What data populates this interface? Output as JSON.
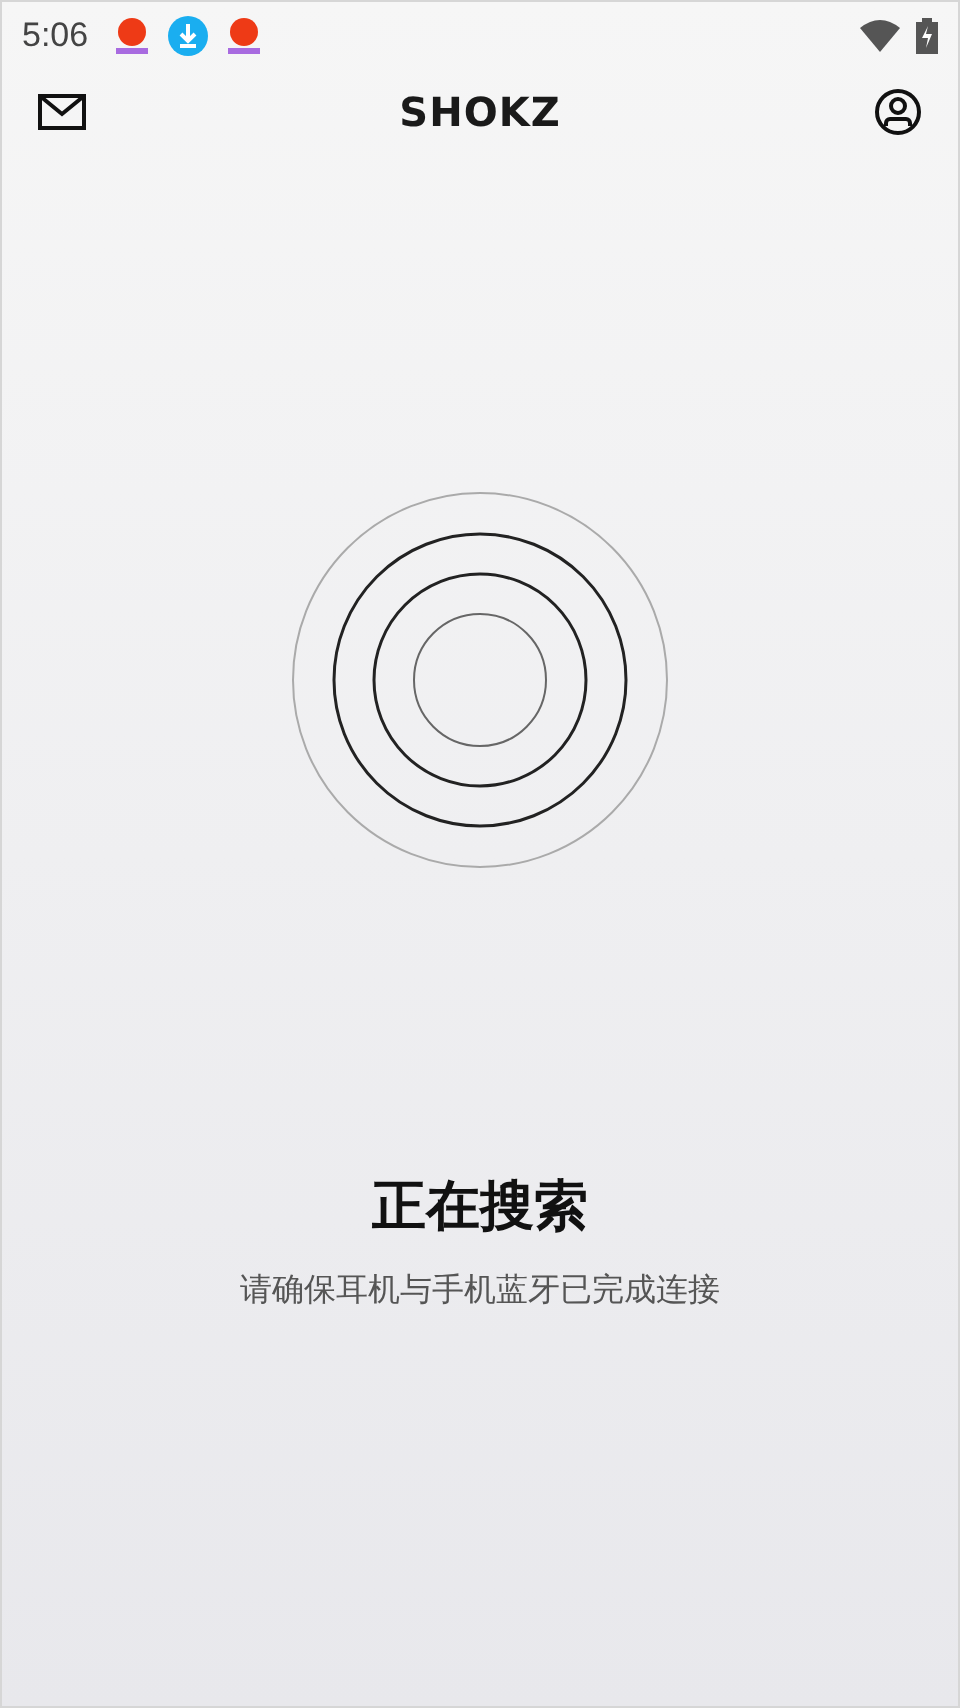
{
  "status_bar": {
    "time": "5:06"
  },
  "header": {
    "logo": "SHOKZ"
  },
  "search": {
    "title": "正在搜索",
    "hint": "请确保耳机与手机蓝牙已完成连接"
  }
}
